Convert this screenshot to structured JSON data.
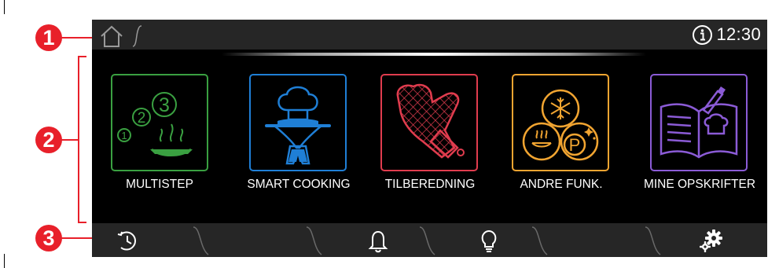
{
  "callouts": [
    "1",
    "2",
    "3"
  ],
  "topbar": {
    "time": "12:30",
    "home_icon": "home-icon",
    "info_icon": "info-icon"
  },
  "tiles": [
    {
      "label": "MULTISTEP",
      "color": "#3aa041",
      "icon": "multistep-icon"
    },
    {
      "label": "SMART COOKING",
      "color": "#1f7fd6",
      "icon": "chef-cloche-icon"
    },
    {
      "label": "TILBEREDNING",
      "color": "#e03c4e",
      "icon": "oven-mitt-icon"
    },
    {
      "label": "ANDRE FUNK.",
      "color": "#f2a531",
      "icon": "other-functions-icon"
    },
    {
      "label": "MINE OPSKRIFTER",
      "color": "#8b5bd6",
      "icon": "recipe-book-icon"
    }
  ],
  "bottombar": {
    "icons": [
      "timer-icon",
      "bell-icon",
      "lightbulb-icon",
      "settings-gears-icon"
    ]
  },
  "colors": {
    "callout": "#e8202a",
    "bar": "#262626",
    "screen": "#000000"
  }
}
